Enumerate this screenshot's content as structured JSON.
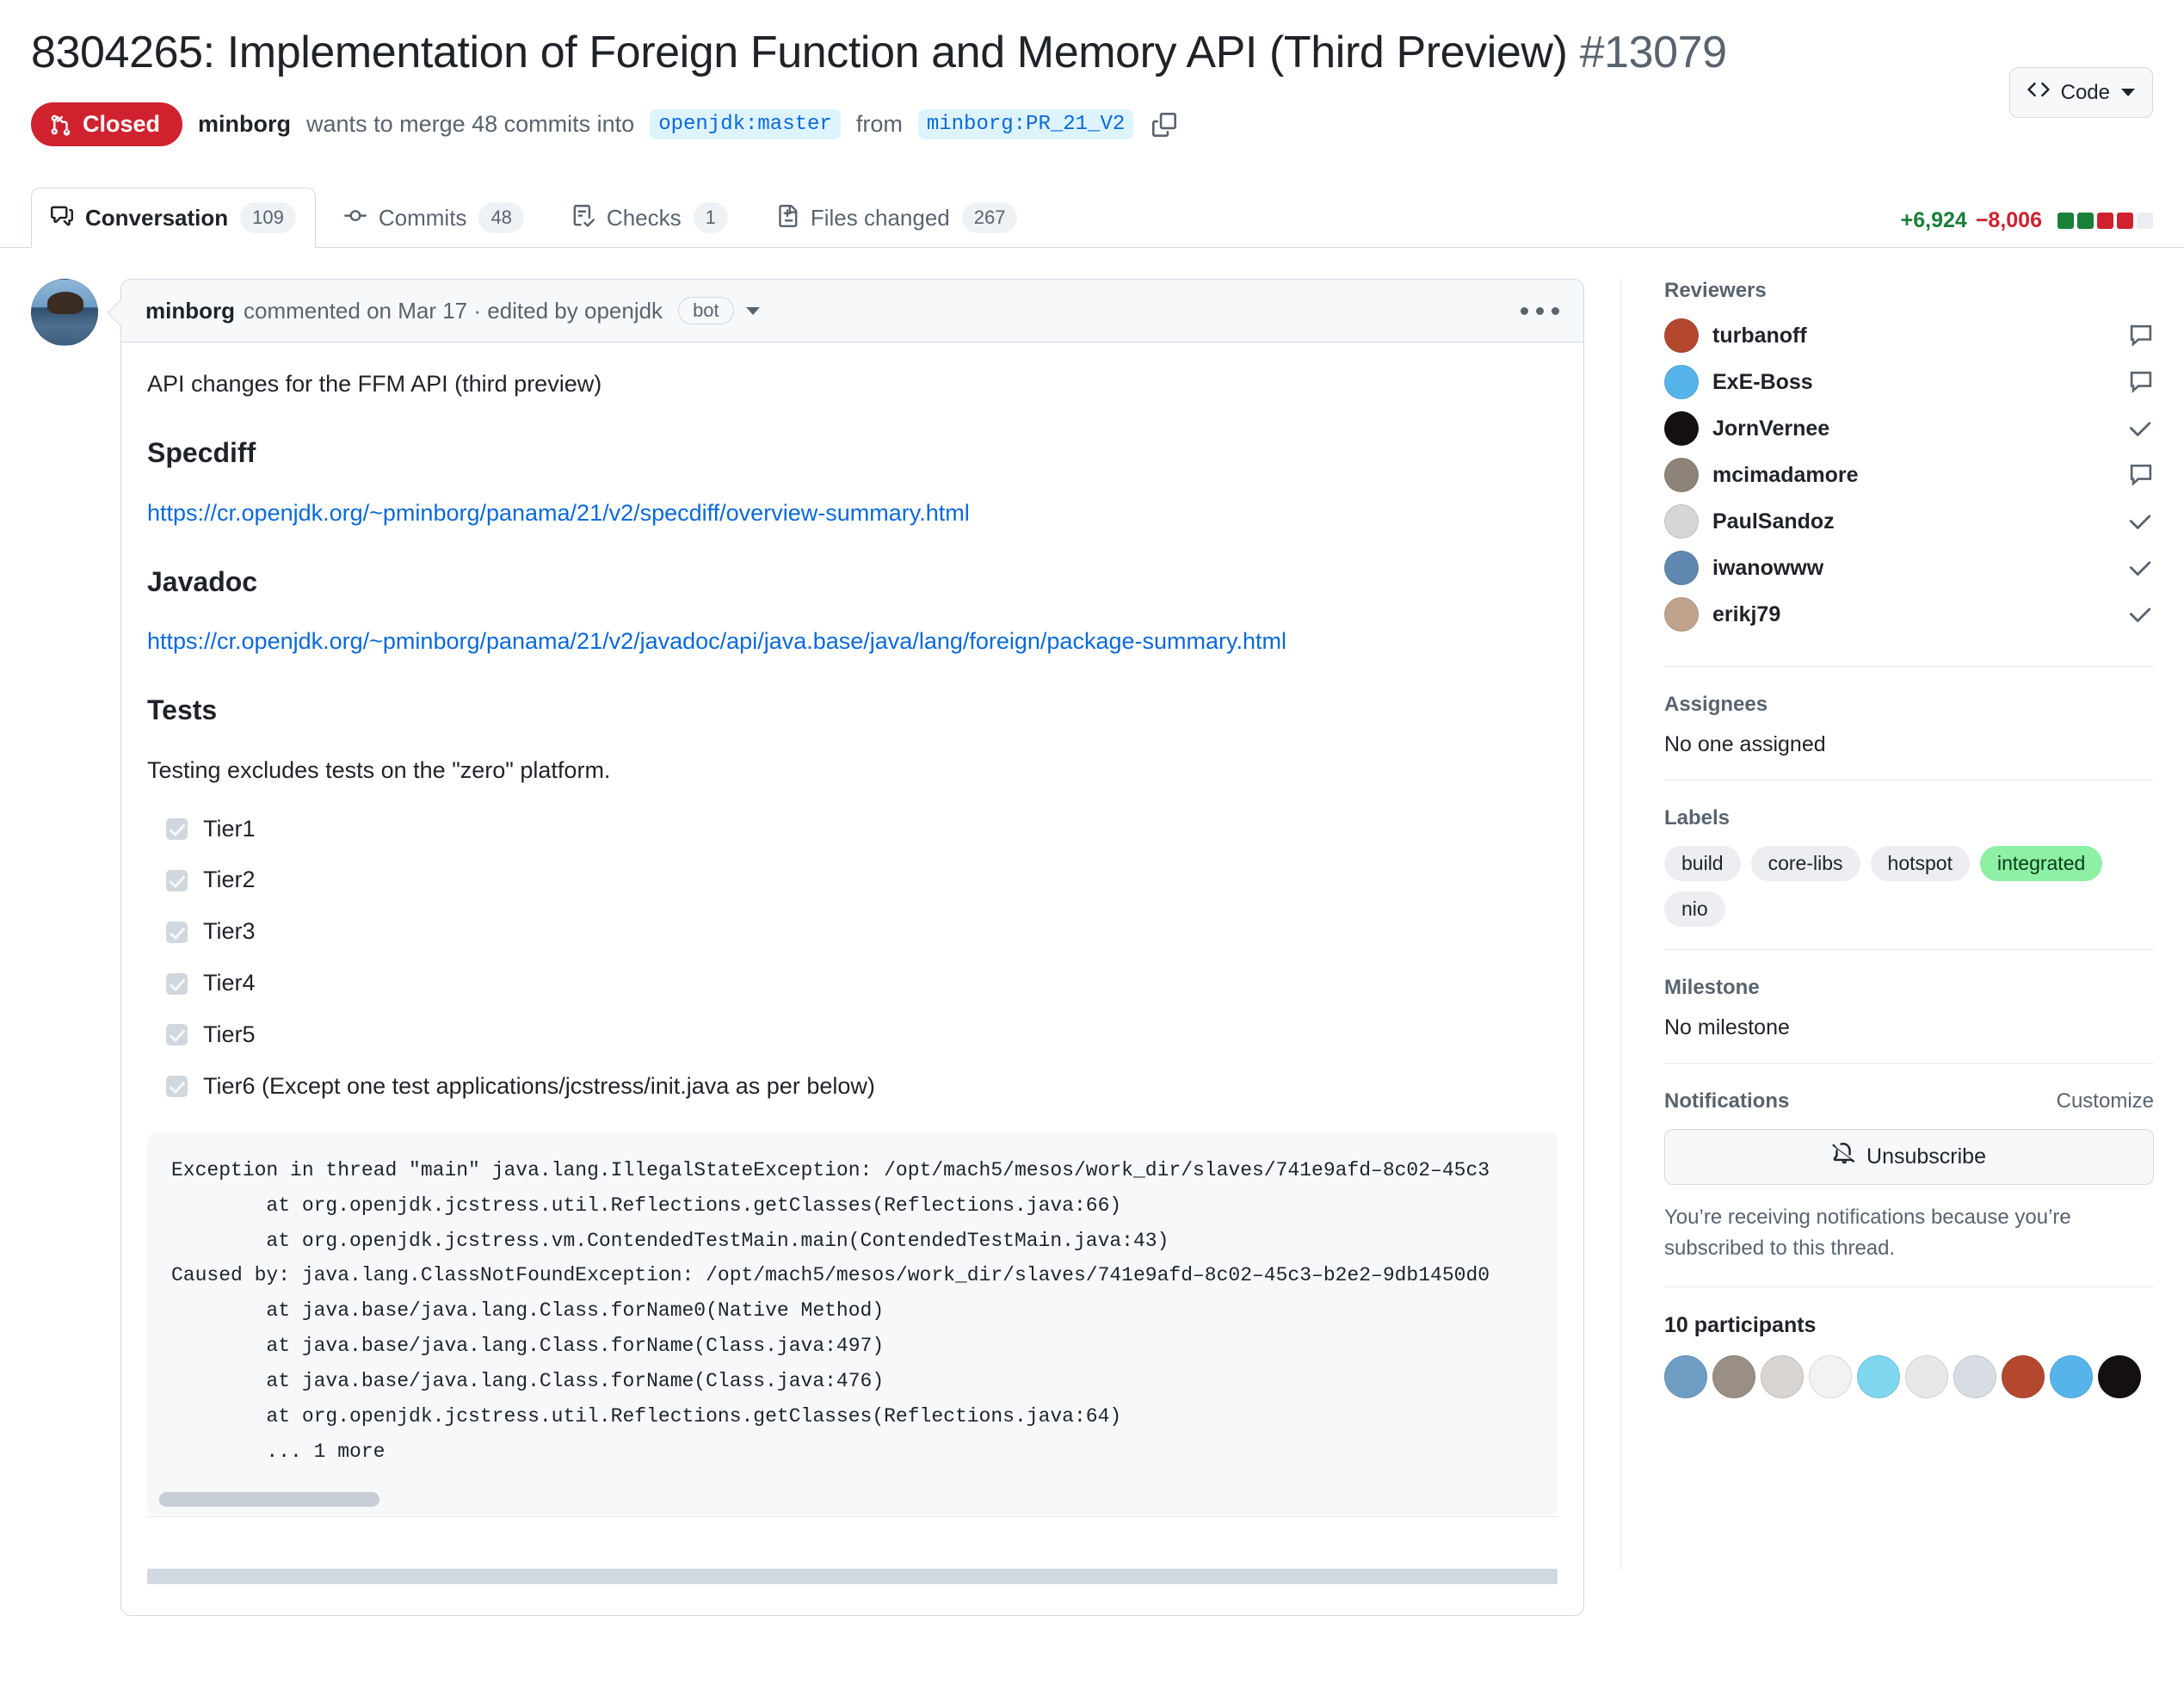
{
  "header": {
    "title": "8304265: Implementation of Foreign Function and Memory API (Third Preview)",
    "number": "#13079",
    "code_button": "Code"
  },
  "state": {
    "badge": "Closed",
    "author": "minborg",
    "text_merge": "wants to merge 48 commits into",
    "base_branch": "openjdk:master",
    "from_word": "from",
    "head_branch": "minborg:PR_21_V2"
  },
  "tabs": [
    {
      "label": "Conversation",
      "count": "109",
      "icon": "comment-discussion-icon",
      "active": true
    },
    {
      "label": "Commits",
      "count": "48",
      "icon": "git-commit-icon",
      "active": false
    },
    {
      "label": "Checks",
      "count": "1",
      "icon": "checklist-icon",
      "active": false
    },
    {
      "label": "Files changed",
      "count": "267",
      "icon": "file-diff-icon",
      "active": false
    }
  ],
  "diffstat": {
    "additions": "+6,924",
    "deletions": "−8,006",
    "blocks": [
      "#1a7f37",
      "#1a7f37",
      "#cf222e",
      "#cf222e",
      "#eaeef2"
    ]
  },
  "comment": {
    "author": "minborg",
    "meta": "commented on Mar 17 · edited by openjdk",
    "bot_chip": "bot",
    "intro": "API changes for the FFM API (third preview)",
    "specdiff_heading": "Specdiff",
    "specdiff_link": "https://cr.openjdk.org/~pminborg/panama/21/v2/specdiff/overview-summary.html",
    "javadoc_heading": "Javadoc",
    "javadoc_link": "https://cr.openjdk.org/~pminborg/panama/21/v2/javadoc/api/java.base/java/lang/foreign/package-summary.html",
    "tests_heading": "Tests",
    "tests_note": "Testing excludes tests on the \"zero\" platform.",
    "tasks": [
      {
        "label": "Tier1",
        "checked": true
      },
      {
        "label": "Tier2",
        "checked": true
      },
      {
        "label": "Tier3",
        "checked": true
      },
      {
        "label": "Tier4",
        "checked": true
      },
      {
        "label": "Tier5",
        "checked": true
      },
      {
        "label": "Tier6 (Except one test applications/jcstress/init.java as per below)",
        "checked": true
      }
    ],
    "code": "Exception in thread \"main\" java.lang.IllegalStateException: /opt/mach5/mesos/work_dir/slaves/741e9afd–8c02–45c3\n        at org.openjdk.jcstress.util.Reflections.getClasses(Reflections.java:66)\n        at org.openjdk.jcstress.vm.ContendedTestMain.main(ContendedTestMain.java:43)\nCaused by: java.lang.ClassNotFoundException: /opt/mach5/mesos/work_dir/slaves/741e9afd–8c02–45c3–b2e2–9db1450d0\n        at java.base/java.lang.Class.forName0(Native Method)\n        at java.base/java.lang.Class.forName(Class.java:497)\n        at java.base/java.lang.Class.forName(Class.java:476)\n        at org.openjdk.jcstress.util.Reflections.getClasses(Reflections.java:64)\n        ... 1 more"
  },
  "sidebar": {
    "reviewers_heading": "Reviewers",
    "reviewers": [
      {
        "name": "turbanoff",
        "state": "comment",
        "color": "#b4482f"
      },
      {
        "name": "ExE-Boss",
        "state": "comment",
        "color": "#57b4ea"
      },
      {
        "name": "JornVernee",
        "state": "approved",
        "color": "#14100f"
      },
      {
        "name": "mcimadamore",
        "state": "comment",
        "color": "#8d8379"
      },
      {
        "name": "PaulSandoz",
        "state": "approved",
        "color": "#d6d6d6"
      },
      {
        "name": "iwanowww",
        "state": "approved",
        "color": "#5f87b0"
      },
      {
        "name": "erikj79",
        "state": "approved",
        "color": "#c0a38c"
      }
    ],
    "assignees_heading": "Assignees",
    "assignees_empty": "No one assigned",
    "labels_heading": "Labels",
    "labels": [
      {
        "name": "build",
        "kind": "default"
      },
      {
        "name": "core-libs",
        "kind": "default"
      },
      {
        "name": "hotspot",
        "kind": "default"
      },
      {
        "name": "integrated",
        "kind": "integrated"
      },
      {
        "name": "nio",
        "kind": "default"
      }
    ],
    "milestone_heading": "Milestone",
    "milestone_empty": "No milestone",
    "notifications_heading": "Notifications",
    "notifications_customize": "Customize",
    "unsubscribe_label": "Unsubscribe",
    "notifications_note": "You’re receiving notifications because you’re subscribed to this thread.",
    "participants_count": "10 participants",
    "participants": [
      {
        "color": "#6e9ec4"
      },
      {
        "color": "#9a8f83"
      },
      {
        "color": "#d8d4d1"
      },
      {
        "color": "#f2f2f2"
      },
      {
        "color": "#7fd6ef"
      },
      {
        "color": "#e8e8e8"
      },
      {
        "color": "#d7dde3"
      },
      {
        "color": "#b4482f"
      },
      {
        "color": "#57b4ea"
      },
      {
        "color": "#14100f"
      }
    ]
  }
}
